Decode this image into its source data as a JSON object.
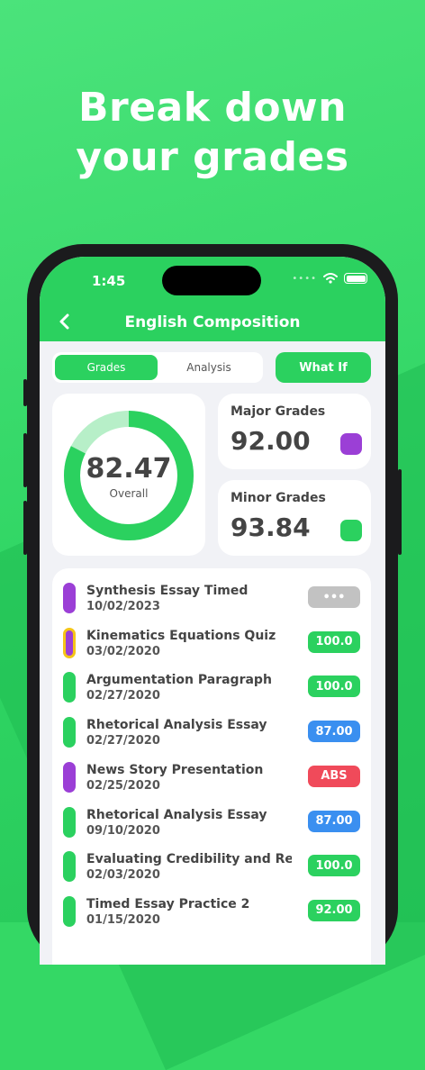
{
  "headline": {
    "line1": "Break down",
    "line2": "your grades"
  },
  "status_bar": {
    "time": "1:45"
  },
  "nav": {
    "title": "English Composition"
  },
  "tabs": [
    {
      "label": "Grades",
      "active": true
    },
    {
      "label": "Analysis",
      "active": false
    }
  ],
  "what_if_label": "What If",
  "overall": {
    "value": "82.47",
    "label": "Overall",
    "fraction": 0.8247
  },
  "major": {
    "label": "Major Grades",
    "value": "92.00",
    "color": "#9b3fd6"
  },
  "minor": {
    "label": "Minor Grades",
    "value": "93.84",
    "color": "#2bd15f"
  },
  "assignments": [
    {
      "name": "Synthesis Essay Timed",
      "date": "10/02/2023",
      "grade": "•••",
      "category_color": "#9b3fd6",
      "pill_color": "#c2c2c2"
    },
    {
      "name": "Kinematics Equations Quiz",
      "date": "03/02/2020",
      "grade": "100.0",
      "category_color": "#9b3fd6",
      "pill_color": "#2bd15f",
      "highlight": true
    },
    {
      "name": "Argumentation Paragraph",
      "date": "02/27/2020",
      "grade": "100.0",
      "category_color": "#2bd15f",
      "pill_color": "#2bd15f"
    },
    {
      "name": "Rhetorical Analysis Essay",
      "date": "02/27/2020",
      "grade": "87.00",
      "category_color": "#2bd15f",
      "pill_color": "#3a8ff0"
    },
    {
      "name": "News Story Presentation",
      "date": "02/25/2020",
      "grade": "ABS",
      "category_color": "#9b3fd6",
      "pill_color": "#f04a5a"
    },
    {
      "name": "Rhetorical Analysis Essay",
      "date": "09/10/2020",
      "grade": "87.00",
      "category_color": "#2bd15f",
      "pill_color": "#3a8ff0"
    },
    {
      "name": "Evaluating Credibility and Reli",
      "date": "02/03/2020",
      "grade": "100.0",
      "category_color": "#2bd15f",
      "pill_color": "#2bd15f"
    },
    {
      "name": "Timed Essay Practice 2",
      "date": "01/15/2020",
      "grade": "92.00",
      "category_color": "#2bd15f",
      "pill_color": "#2bd15f"
    }
  ]
}
